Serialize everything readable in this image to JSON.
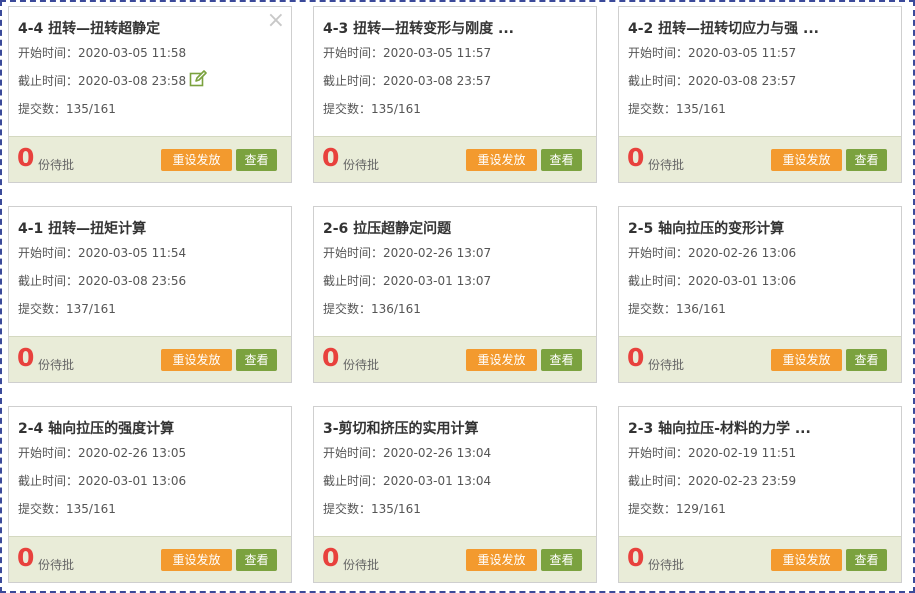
{
  "labels": {
    "start_prefix": "开始时间：",
    "end_prefix": "截止时间：",
    "submit_prefix": "提交数：",
    "pending_suffix": "份待批",
    "reset_button": "重设发放",
    "view_button": "查看"
  },
  "icons": {
    "close": "×",
    "edit": "edit-icon"
  },
  "colors": {
    "count": "#e8413d",
    "reset_button": "#f39a2e",
    "view_button": "#7ba23f",
    "footer": "#e9ecd8"
  },
  "cards": [
    {
      "title": "4-4 扭转—扭转超静定",
      "start": "2020-03-05 11:58",
      "end": "2020-03-08 23:58",
      "submit": "135/161",
      "pending": "0"
    },
    {
      "title": "4-3 扭转—扭转变形与刚度 ...",
      "start": "2020-03-05 11:57",
      "end": "2020-03-08 23:57",
      "submit": "135/161",
      "pending": "0"
    },
    {
      "title": "4-2 扭转—扭转切应力与强 ...",
      "start": "2020-03-05 11:57",
      "end": "2020-03-08 23:57",
      "submit": "135/161",
      "pending": "0"
    },
    {
      "title": "4-1 扭转—扭矩计算",
      "start": "2020-03-05 11:54",
      "end": "2020-03-08 23:56",
      "submit": "137/161",
      "pending": "0"
    },
    {
      "title": "2-6 拉压超静定问题",
      "start": "2020-02-26 13:07",
      "end": "2020-03-01 13:07",
      "submit": "136/161",
      "pending": "0"
    },
    {
      "title": "2-5 轴向拉压的变形计算",
      "start": "2020-02-26 13:06",
      "end": "2020-03-01 13:06",
      "submit": "136/161",
      "pending": "0"
    },
    {
      "title": "2-4 轴向拉压的强度计算",
      "start": "2020-02-26 13:05",
      "end": "2020-03-01 13:06",
      "submit": "135/161",
      "pending": "0"
    },
    {
      "title": "3-剪切和挤压的实用计算",
      "start": "2020-02-26 13:04",
      "end": "2020-03-01 13:04",
      "submit": "135/161",
      "pending": "0"
    },
    {
      "title": "2-3 轴向拉压-材料的力学 ...",
      "start": "2020-02-19 11:51",
      "end": "2020-02-23 23:59",
      "submit": "129/161",
      "pending": "0"
    }
  ]
}
